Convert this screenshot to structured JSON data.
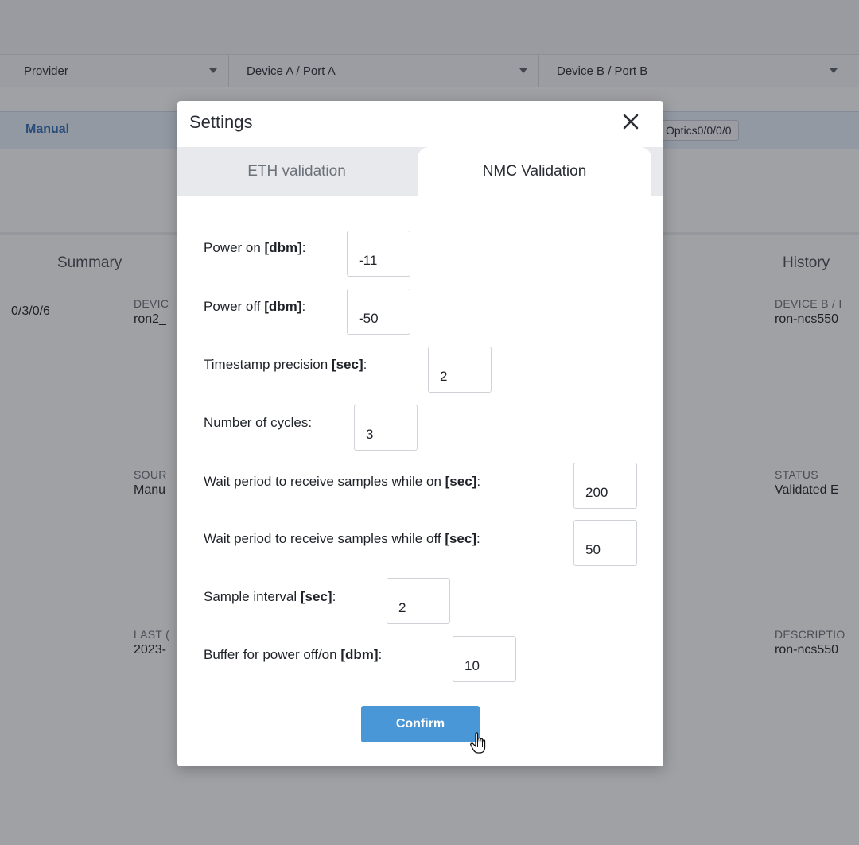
{
  "background": {
    "filters": [
      {
        "label": "Provider"
      },
      {
        "label": "Device A / Port A"
      },
      {
        "label": "Device B / Port B"
      }
    ],
    "selected_row": {
      "provider": "Manual",
      "port_b": "Optics0/0/0/0"
    },
    "tabs": {
      "summary": "Summary",
      "history": "History"
    },
    "left_partial": {
      "port": "0/3/0/6",
      "device_label": "DEVIC",
      "device_value": "ron2_",
      "source_label": "SOUR",
      "source_value": "Manu",
      "last_label": "LAST (",
      "last_value": "2023-"
    },
    "right_partial": {
      "device_b_label": "DEVICE B / I",
      "device_b_value": "ron-ncs550",
      "status_label": "STATUS",
      "status_value": "Validated E",
      "description_label": "DESCRIPTIO",
      "description_value": "ron-ncs550"
    }
  },
  "modal": {
    "title": "Settings",
    "close_icon": "close-icon",
    "tabs": [
      {
        "label": "ETH validation",
        "active": false
      },
      {
        "label": "NMC Validation",
        "active": true
      }
    ],
    "fields": [
      {
        "label": "Power on ",
        "unit": "[dbm]",
        "suffix": ":",
        "value": "-11"
      },
      {
        "label": "Power off ",
        "unit": "[dbm]",
        "suffix": ":",
        "value": "-50"
      },
      {
        "label": "Timestamp precision ",
        "unit": "[sec]",
        "suffix": ":",
        "value": "2"
      },
      {
        "label": "Number of cycles:",
        "unit": "",
        "suffix": "",
        "value": "3"
      },
      {
        "label": "Wait period to receive samples while on ",
        "unit": "[sec]",
        "suffix": ":",
        "value": "200"
      },
      {
        "label": "Wait period to receive samples while off ",
        "unit": "[sec]",
        "suffix": ":",
        "value": "50"
      },
      {
        "label": "Sample interval ",
        "unit": "[sec]",
        "suffix": ":",
        "value": "2"
      },
      {
        "label": "Buffer for power off/on ",
        "unit": "[dbm]",
        "suffix": ":",
        "value": "10"
      }
    ],
    "confirm_label": "Confirm"
  },
  "colors": {
    "accent": "#4a97d8",
    "link": "#2f6db5",
    "overlay": "#1c2028"
  }
}
